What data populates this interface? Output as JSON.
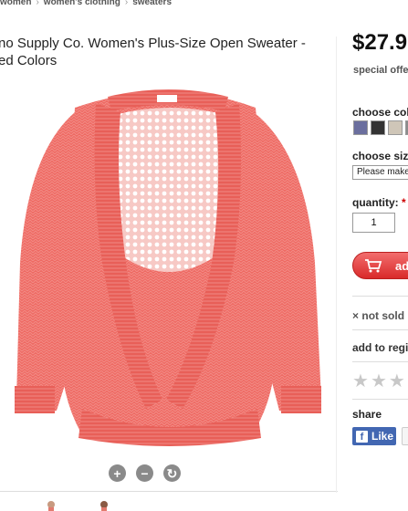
{
  "breadcrumb": [
    "women",
    "women's clothing",
    "sweaters"
  ],
  "product": {
    "title_line1": "no Supply Co. Women's Plus-Size Open Sweater -",
    "title_line2": "ed Colors",
    "price": "$27.9",
    "special_offer": "special offe"
  },
  "options": {
    "color_label": "choose col",
    "swatch_colors": [
      "#6b6f9e",
      "#333333",
      "#cfc6b8",
      "#8c8c8c"
    ],
    "size_label": "choose siz",
    "size_value": "Please make",
    "quantity_label": "quantity:",
    "required_mark": "*",
    "quantity_value": "1"
  },
  "actions": {
    "add_label": "ad",
    "not_sold": "not sold i",
    "not_sold_icon": "×",
    "registry": "add to regi",
    "star_glyph": "★",
    "stars": 3,
    "share_label": "share",
    "like_label": "Like",
    "facebook_f": "f"
  },
  "zoom": [
    "+",
    "−",
    "↻"
  ],
  "colors": {
    "sweater": "#ee6a63",
    "accent": "#d92a2a",
    "facebook": "#4267b2"
  }
}
